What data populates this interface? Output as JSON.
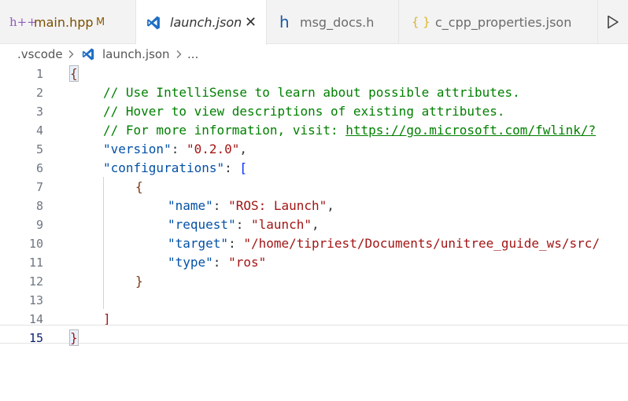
{
  "tabs": [
    {
      "label": "main.hpp",
      "icon": "h++",
      "badge": "M",
      "icon_name": "cpp-header-icon"
    },
    {
      "label": "launch.json",
      "icon_name": "vscode-icon",
      "close": "✕"
    },
    {
      "label": "msg_docs.h",
      "icon": "h",
      "icon_name": "c-header-icon"
    },
    {
      "label": "c_cpp_properties.json",
      "icon": "{ }",
      "icon_name": "json-icon"
    }
  ],
  "breadcrumb": {
    "folder": ".vscode",
    "file": "launch.json",
    "ellipsis": "..."
  },
  "editor": {
    "line_numbers": [
      "1",
      "2",
      "3",
      "4",
      "5",
      "6",
      "7",
      "8",
      "9",
      "10",
      "11",
      "12",
      "13",
      "14",
      "15"
    ],
    "current_line": "15",
    "lines": {
      "l1_brace": "{",
      "l2_comment": "// Use IntelliSense to learn about possible attributes.",
      "l3_comment": "// Hover to view descriptions of existing attributes.",
      "l4_comment": "// For more information, visit: ",
      "l4_link": "https://go.microsoft.com/fwlink/?",
      "l5_key": "\"version\"",
      "l5_colon": ": ",
      "l5_value": "\"0.2.0\"",
      "l5_comma": ",",
      "l6_key": "\"configurations\"",
      "l6_colon": ": ",
      "l6_bracket": "[",
      "l7_brace": "{",
      "l8_key": "\"name\"",
      "l8_colon": ": ",
      "l8_value": "\"ROS: Launch\"",
      "l8_comma": ",",
      "l9_key": "\"request\"",
      "l9_colon": ": ",
      "l9_value": "\"launch\"",
      "l9_comma": ",",
      "l10_key": "\"target\"",
      "l10_colon": ": ",
      "l10_value": "\"/home/tipriest/Documents/unitree_guide_ws/src/",
      "l11_key": "\"type\"",
      "l11_colon": ": ",
      "l11_value": "\"ros\"",
      "l12_brace": "}",
      "l14_bracket": "]",
      "l15_brace": "}"
    }
  },
  "colors": {
    "comment": "#008000",
    "key": "#0451a5",
    "string": "#a31515",
    "bracket_level1": "#0431fa",
    "bracket_level2": "#319331",
    "bracket_level3": "#7b3814"
  }
}
